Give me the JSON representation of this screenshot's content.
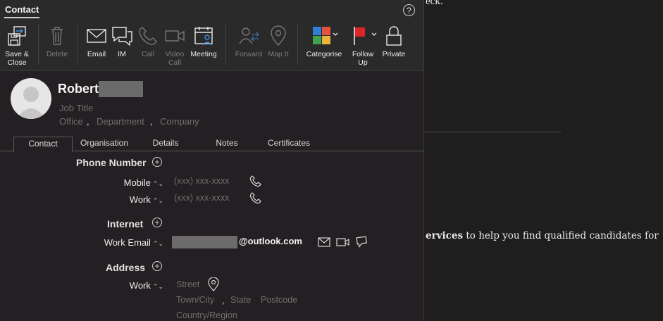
{
  "window": {
    "title": "Contact",
    "help_label": "?"
  },
  "ribbon": {
    "save_close": "Save & Close",
    "delete": "Delete",
    "email": "Email",
    "im": "IM",
    "call": "Call",
    "video_call": "Video Call",
    "meeting": "Meeting",
    "forward": "Forward",
    "map_it": "Map It",
    "categorise": "Categorise",
    "follow_up": "Follow Up",
    "private": "Private"
  },
  "contact": {
    "first_name": "Robert",
    "job_title_placeholder": "Job Title",
    "office_placeholder": "Office",
    "department_placeholder": "Department",
    "company_placeholder": "Company"
  },
  "tabs": [
    "Contact",
    "Organisation",
    "Details",
    "Notes",
    "Certificates"
  ],
  "form": {
    "phone_section": "Phone Number",
    "mobile_label": "Mobile",
    "mobile_placeholder": "(xxx) xxx-xxxx",
    "work_phone_label": "Work",
    "work_phone_placeholder": "(xxx) xxx-xxxx",
    "internet_section": "Internet",
    "work_email_label": "Work Email",
    "email_domain": "@outlook.com",
    "address_section": "Address",
    "work_address_label": "Work",
    "street_placeholder": "Street",
    "town_placeholder": "Town/City",
    "state_placeholder": "State",
    "postcode_placeholder": "Postcode",
    "country_placeholder": "Country/Region"
  },
  "background_doc": {
    "top_text": "eck.",
    "para_bold": "ervices",
    "para_rest": " to help you find qualified candidates for"
  },
  "colors": {
    "window_bg": "#231f22",
    "ribbon_bg": "#2b2a2b",
    "accent_blue": "#2f7fd6",
    "flag_red": "#e0242c"
  }
}
